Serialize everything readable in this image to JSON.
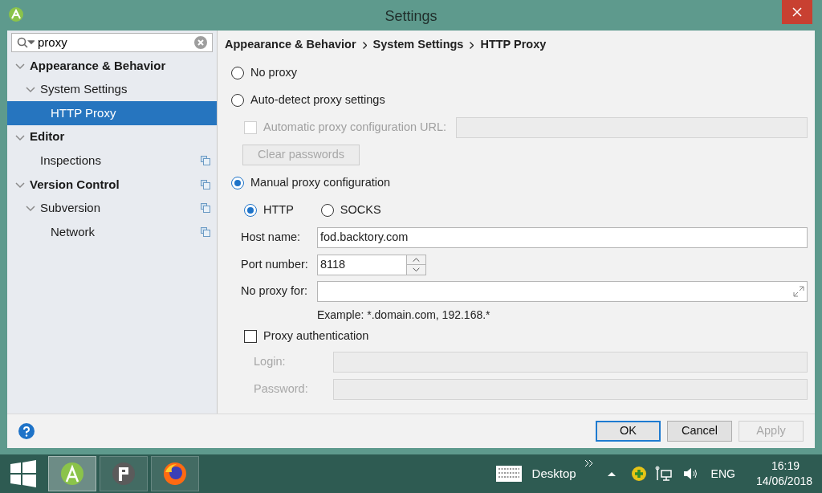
{
  "window": {
    "title": "Settings"
  },
  "search": {
    "value": "proxy"
  },
  "tree": [
    {
      "label": "Appearance & Behavior",
      "bold": true,
      "expanded": true,
      "selected": false,
      "children": [
        {
          "label": "System Settings",
          "bold": false,
          "expanded": true,
          "selected": false,
          "children": [
            {
              "label": "HTTP Proxy",
              "bold": false,
              "selected": true,
              "project_level": false
            }
          ]
        }
      ]
    },
    {
      "label": "Editor",
      "bold": true,
      "expanded": true,
      "selected": false,
      "children": [
        {
          "label": "Inspections",
          "bold": false,
          "selected": false,
          "project_level": true
        }
      ]
    },
    {
      "label": "Version Control",
      "bold": true,
      "expanded": true,
      "selected": false,
      "project_level": true,
      "children": [
        {
          "label": "Subversion",
          "bold": false,
          "expanded": true,
          "selected": false,
          "project_level": true,
          "children": [
            {
              "label": "Network",
              "bold": false,
              "selected": false,
              "project_level": true
            }
          ]
        }
      ]
    }
  ],
  "breadcrumb": [
    "Appearance & Behavior",
    "System Settings",
    "HTTP Proxy"
  ],
  "proxy_modes": [
    {
      "label": "No proxy",
      "selected": false
    },
    {
      "label": "Auto-detect proxy settings",
      "selected": false
    },
    {
      "label": "Manual proxy configuration",
      "selected": true
    }
  ],
  "auto_detect": {
    "pac_checkbox": {
      "label": "Automatic proxy configuration URL:",
      "checked": false,
      "disabled": true
    },
    "clear_passwords": {
      "label": "Clear passwords",
      "disabled": true
    }
  },
  "manual": {
    "protocols": [
      {
        "label": "HTTP",
        "selected": true
      },
      {
        "label": "SOCKS",
        "selected": false
      }
    ],
    "host": {
      "label": "Host name:",
      "value": "fod.backtory.com"
    },
    "port": {
      "label": "Port number:",
      "value": "8118"
    },
    "no_proxy": {
      "label": "No proxy for:"
    },
    "example": "Example: *.domain.com, 192.168.*",
    "auth": {
      "label": "Proxy authentication",
      "checked": false
    },
    "login": {
      "label": "Login:",
      "disabled": true
    },
    "password": {
      "label": "Password:",
      "disabled": true
    }
  },
  "buttons": [
    {
      "label": "OK",
      "default": true,
      "disabled": false
    },
    {
      "label": "Cancel",
      "default": false,
      "disabled": false
    },
    {
      "label": "Apply",
      "default": false,
      "disabled": true
    }
  ],
  "taskbar": {
    "apps": [
      {
        "kind": "android",
        "active": true
      },
      {
        "kind": "psiphon",
        "active": false
      },
      {
        "kind": "firefox",
        "active": false
      }
    ],
    "desktop": "Desktop",
    "language": "ENG",
    "time": "16:19",
    "date": "14/06/2018"
  }
}
